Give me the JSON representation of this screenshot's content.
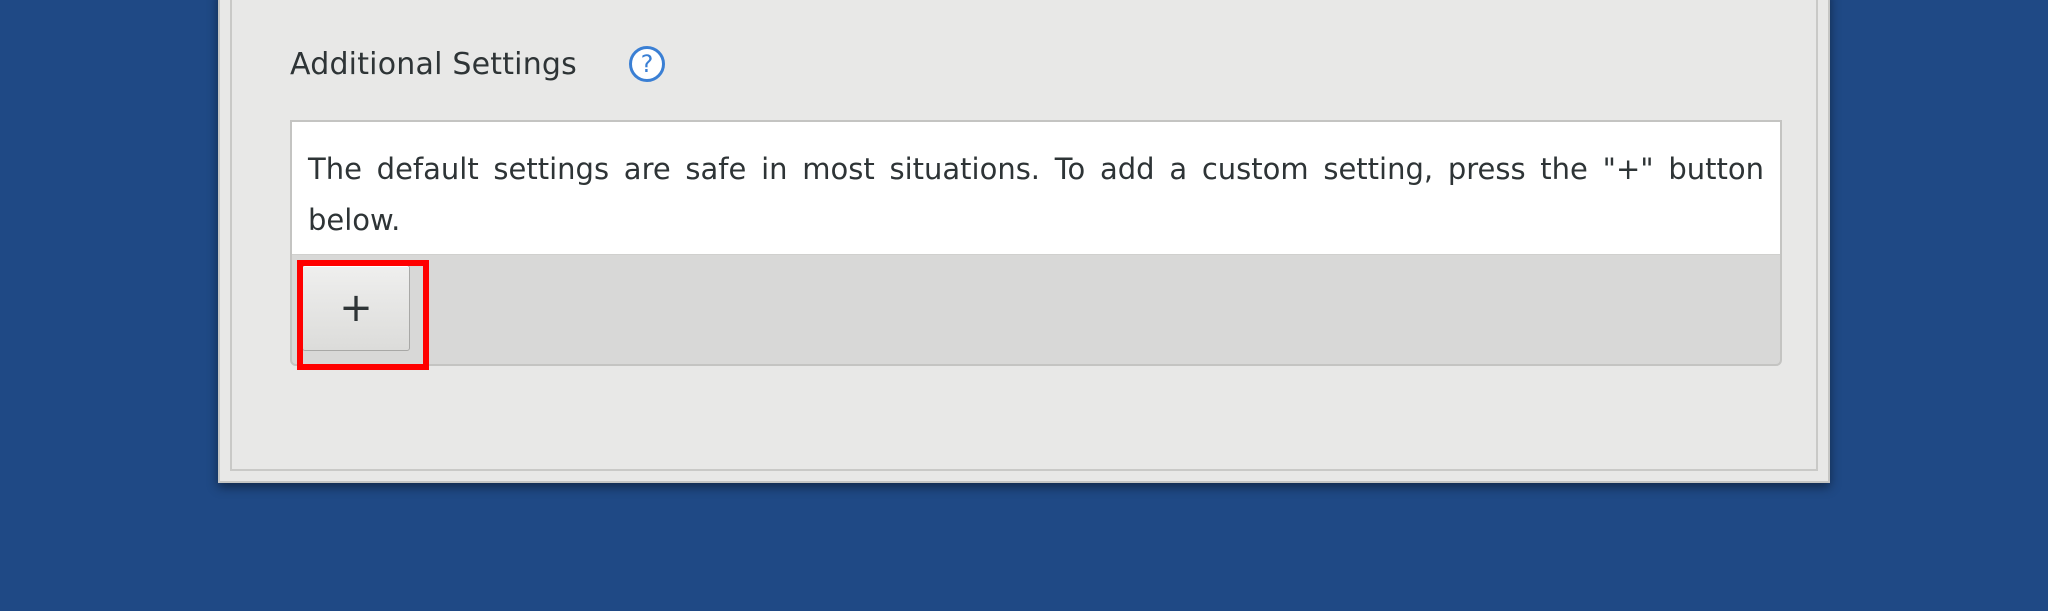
{
  "section": {
    "title": "Additional Settings",
    "help_icon": "question-circle-icon",
    "help_glyph": "?"
  },
  "settings_box": {
    "info_text": "The default settings are safe in most situations. To add a custom setting, press the \"+\" button below."
  },
  "toolbar": {
    "add_label": "+"
  },
  "colors": {
    "desktop_background": "#1f4985",
    "dialog_background": "#e8e8e7",
    "help_icon": "#3a7fd4",
    "highlight": "#ff0000"
  }
}
